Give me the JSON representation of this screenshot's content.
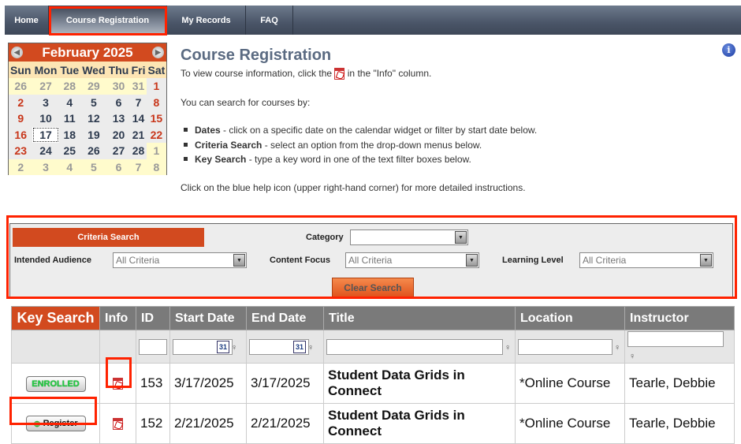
{
  "nav": {
    "tabs": [
      {
        "label": "Home"
      },
      {
        "label": "Course Registration",
        "active": true
      },
      {
        "label": "My Records"
      },
      {
        "label": "FAQ"
      }
    ]
  },
  "calendar": {
    "month": "February 2025",
    "days": [
      "Sun",
      "Mon",
      "Tue",
      "Wed",
      "Thu",
      "Fri",
      "Sat"
    ],
    "weeks": [
      [
        "26",
        "27",
        "28",
        "29",
        "30",
        "31",
        "1"
      ],
      [
        "2",
        "3",
        "4",
        "5",
        "6",
        "7",
        "8"
      ],
      [
        "9",
        "10",
        "11",
        "12",
        "13",
        "14",
        "15"
      ],
      [
        "16",
        "17",
        "18",
        "19",
        "20",
        "21",
        "22"
      ],
      [
        "23",
        "24",
        "25",
        "26",
        "27",
        "28",
        "1"
      ],
      [
        "2",
        "3",
        "4",
        "5",
        "6",
        "7",
        "8"
      ]
    ],
    "today": "17",
    "prev_icon": "arrow-left-icon",
    "next_icon": "arrow-right-icon"
  },
  "page": {
    "title": "Course Registration",
    "intro_before": "To view course information, click the",
    "intro_after": "in the \"Info\" column.",
    "search_intro": "You can search for courses by:",
    "bullets": [
      {
        "term": "Dates",
        "text": " - click on a specific date on the calendar widget or filter by start date below."
      },
      {
        "term": "Criteria Search",
        "text": " - select an option from the drop-down menus below."
      },
      {
        "term": "Key Search",
        "text": " - type a key word in one of the text filter boxes below."
      }
    ],
    "help_text": "Click on the blue help icon (upper right-hand corner) for more detailed instructions."
  },
  "criteria": {
    "title": "Criteria Search",
    "category_label": "Category",
    "category_value": "",
    "audience_label": "Intended Audience",
    "audience_value": "All Criteria",
    "focus_label": "Content Focus",
    "focus_value": "All Criteria",
    "level_label": "Learning Level",
    "level_value": "All Criteria",
    "clear_label": "Clear Search"
  },
  "grid": {
    "headers": [
      "Key Search",
      "Info",
      "ID",
      "Start Date",
      "End Date",
      "Title",
      "Location",
      "Instructor"
    ],
    "calendar_icon_text": "31",
    "rows": [
      {
        "action": "ENROLLED",
        "id": "153",
        "start": "3/17/2025",
        "end": "3/17/2025",
        "title": "Student Data Grids in Connect",
        "location": "*Online Course",
        "instructor": "Tearle, Debbie"
      },
      {
        "action": "Register",
        "id": "152",
        "start": "2/21/2025",
        "end": "2/21/2025",
        "title": "Student Data Grids in Connect",
        "location": "*Online Course",
        "instructor": "Tearle, Debbie"
      }
    ]
  },
  "colors": {
    "accent": "#d24a1f",
    "nav": "#4a5568",
    "highlight": "#ff2200",
    "enrolled": "#22cc44"
  }
}
